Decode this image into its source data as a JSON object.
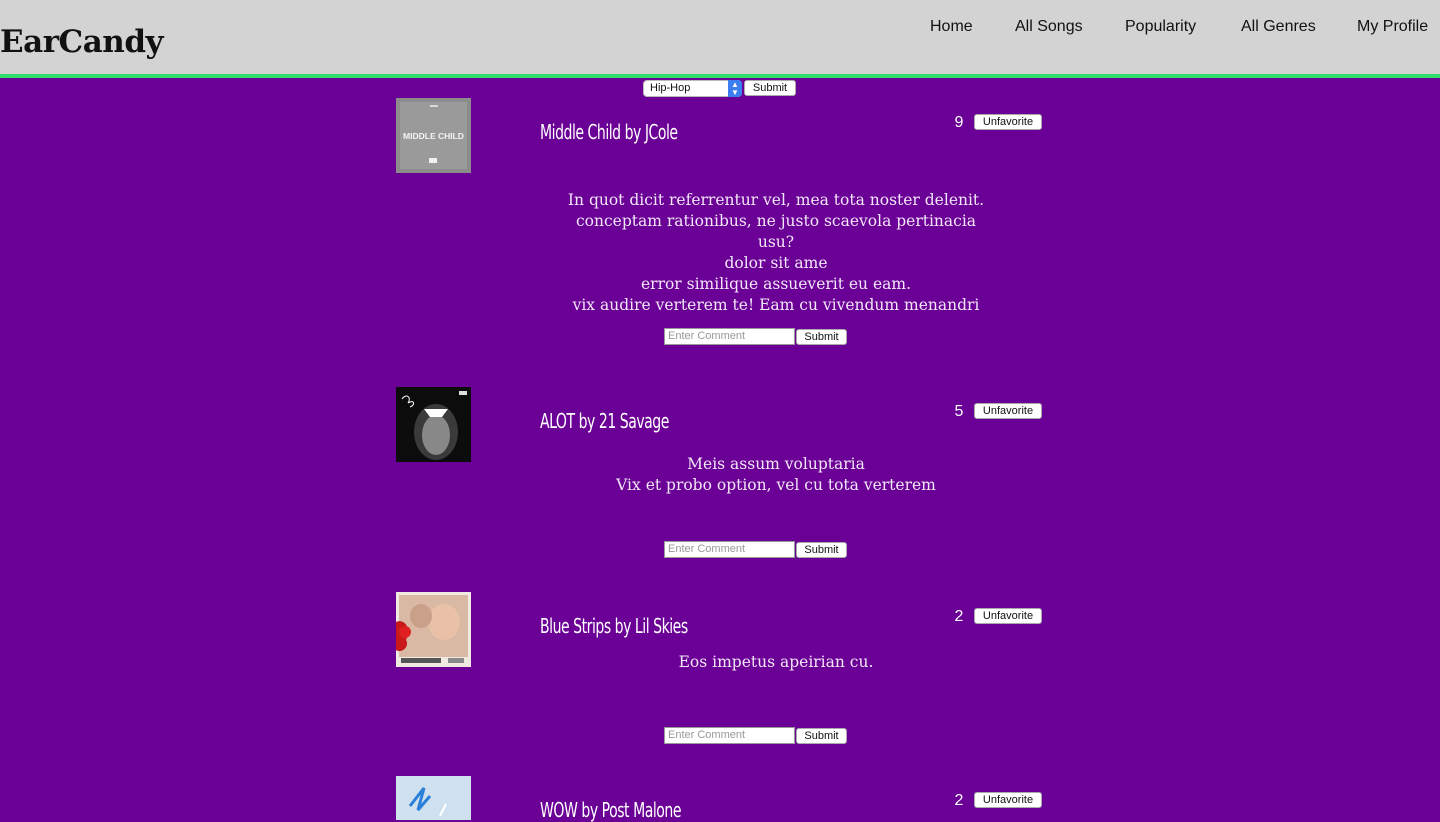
{
  "app": {
    "logo": "EarCandy"
  },
  "nav": {
    "items": [
      {
        "label": "Home"
      },
      {
        "label": "All Songs"
      },
      {
        "label": "Popularity"
      },
      {
        "label": "All Genres"
      },
      {
        "label": "My Profile"
      }
    ]
  },
  "genre_filter": {
    "selected": "Hip-Hop",
    "submit_label": "Submit"
  },
  "songs": [
    {
      "title": "Middle Child by JCole",
      "favorites": "9",
      "unfavorite_label": "Unfavorite",
      "cover_text": "MIDDLE CHILD",
      "lyrics": [
        "In quot dicit referrentur vel, mea tota noster delenit.",
        "conceptam rationibus, ne justo scaevola pertinacia",
        "usu?",
        "dolor sit ame",
        "error similique assueverit eu eam.",
        "vix audire verterem te! Eam cu vivendum menandri"
      ],
      "comment_placeholder": "Enter Comment",
      "submit_label": "Submit"
    },
    {
      "title": "ALOT by 21 Savage",
      "favorites": "5",
      "unfavorite_label": "Unfavorite",
      "lyrics": [
        "Meis assum voluptaria",
        "Vix et probo option, vel cu tota verterem"
      ],
      "comment_placeholder": "Enter Comment",
      "submit_label": "Submit"
    },
    {
      "title": "Blue Strips by Lil Skies",
      "favorites": "2",
      "unfavorite_label": "Unfavorite",
      "lyrics": [
        "Eos impetus apeirian cu."
      ],
      "comment_placeholder": "Enter Comment",
      "submit_label": "Submit"
    },
    {
      "title": "WOW by Post Malone",
      "favorites": "2",
      "unfavorite_label": "Unfavorite"
    }
  ]
}
